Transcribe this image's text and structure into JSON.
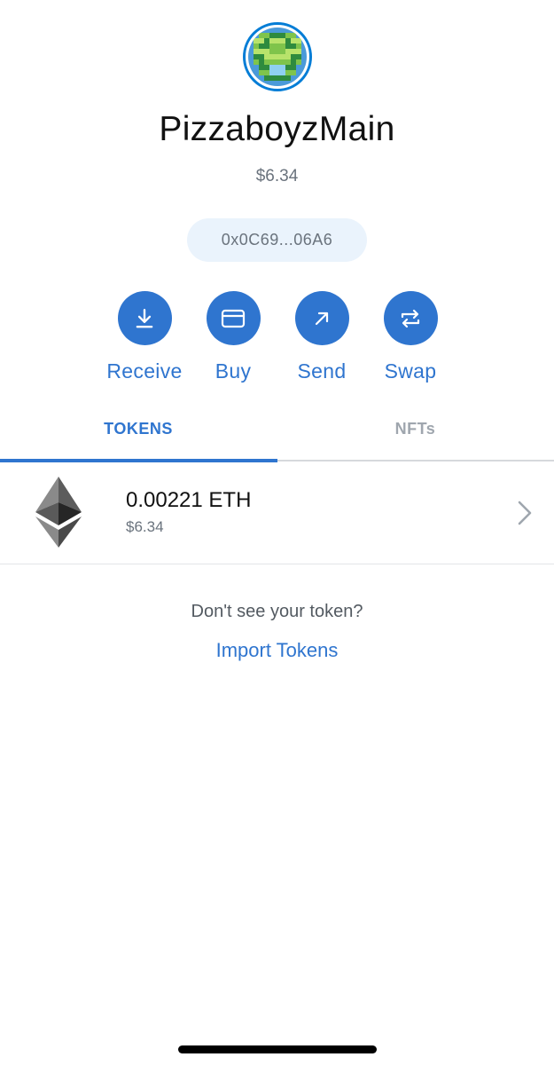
{
  "account": {
    "name": "PizzaboyzMain",
    "balance": "$6.34",
    "address": "0x0C69...06A6"
  },
  "actions": [
    {
      "label": "Receive",
      "icon": "download-icon"
    },
    {
      "label": "Buy",
      "icon": "card-icon"
    },
    {
      "label": "Send",
      "icon": "arrow-up-right-icon"
    },
    {
      "label": "Swap",
      "icon": "swap-icon"
    }
  ],
  "tabs": {
    "tokens": "TOKENS",
    "nfts": "NFTs",
    "active": "tokens"
  },
  "tokens": [
    {
      "amount": "0.00221 ETH",
      "fiat": "$6.34",
      "icon": "ethereum-icon"
    }
  ],
  "import": {
    "prompt": "Don't see your token?",
    "link": "Import Tokens"
  },
  "colors": {
    "accent": "#2f75cf",
    "address_pill_bg": "#eaf3fc",
    "muted_text": "#6a737d"
  }
}
